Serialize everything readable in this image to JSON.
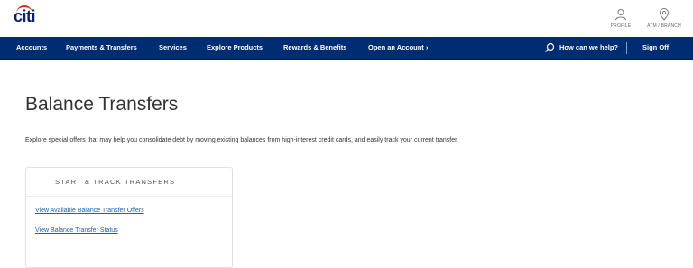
{
  "header": {
    "logo_text": "citi",
    "utilities": [
      {
        "label": "PROFILE",
        "icon": "person-icon"
      },
      {
        "label": "ATM / BRANCH",
        "icon": "location-pin-icon"
      }
    ]
  },
  "nav": {
    "items": [
      {
        "label": "Accounts"
      },
      {
        "label": "Payments & Transfers"
      },
      {
        "label": "Services"
      },
      {
        "label": "Explore Products"
      },
      {
        "label": "Rewards & Benefits"
      },
      {
        "label": "Open an Account ›"
      }
    ],
    "search_label": "How can we help?",
    "signoff_label": "Sign Off",
    "colors": {
      "nav_background": "#002d72",
      "link": "#0f67b6",
      "logo_arc": "#e1251b"
    }
  },
  "main": {
    "title": "Balance Transfers",
    "intro": "Explore special offers that may help you consolidate debt by moving existing balances from high-interest credit cards, and easily track your current transfer.",
    "card": {
      "title": "START & TRACK TRANSFERS",
      "links": [
        {
          "label": "View Available Balance Transfer Offers"
        },
        {
          "label": "View Balance Transfer Status"
        }
      ]
    }
  }
}
